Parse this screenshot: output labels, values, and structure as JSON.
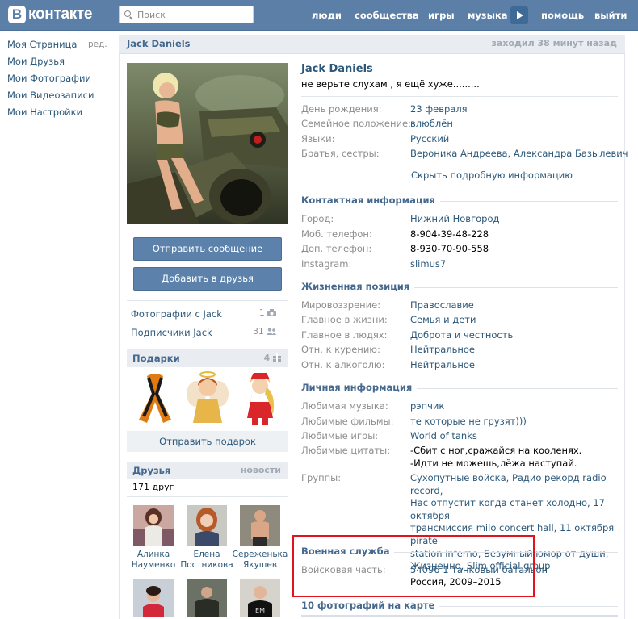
{
  "brand": {
    "logo_letter": "В",
    "logo_text": "контакте"
  },
  "search": {
    "placeholder": "Поиск"
  },
  "topnav": [
    "люди",
    "сообщества",
    "игры",
    "музыка",
    "помощь",
    "выйти"
  ],
  "leftmenu": {
    "items": [
      "Моя Страница",
      "Мои Друзья",
      "Мои Фотографии",
      "Мои Видеозаписи",
      "Мои Настройки"
    ],
    "edit": "ред."
  },
  "header": {
    "name": "Jack Daniels",
    "last_seen": "заходил 38 минут назад"
  },
  "actions": {
    "message": "Отправить сообщение",
    "add_friend": "Добавить в друзья"
  },
  "side_links": [
    {
      "label": "Фотографии с Jack",
      "count": "1"
    },
    {
      "label": "Подписчики Jack",
      "count": "31"
    }
  ],
  "gifts": {
    "title": "Подарки",
    "count": "4",
    "send": "Отправить подарок"
  },
  "friends": {
    "title": "Друзья",
    "news": "новости",
    "count_text": "171 друг",
    "people": [
      {
        "first": "Алинка",
        "last": "Науменко"
      },
      {
        "first": "Елена",
        "last": "Постникова"
      },
      {
        "first": "Сереженька",
        "last": "Якушев"
      }
    ]
  },
  "profile": {
    "name": "Jack Daniels",
    "status": "не верьте слухам , я ещё хуже.........",
    "basic": [
      {
        "label": "День рождения:",
        "value": "23 февраля"
      },
      {
        "label": "Семейное положение:",
        "value": "влюблён"
      },
      {
        "label": "Языки:",
        "value": "Русский"
      },
      {
        "label": "Братья, сестры:",
        "value": "Вероника Андреева, Александра Базылевич"
      }
    ],
    "hide_details": "Скрыть подробную информацию",
    "contacts_title": "Контактная информация",
    "contacts": [
      {
        "label": "Город:",
        "value": "Нижний Новгород"
      },
      {
        "label": "Моб. телефон:",
        "value": "8-904-39-48-228"
      },
      {
        "label": "Доп. телефон:",
        "value": "8-930-70-90-558"
      },
      {
        "label": "Instagram:",
        "value": "slimus7"
      }
    ],
    "life_title": "Жизненная позиция",
    "life": [
      {
        "label": "Мировоззрение:",
        "value": "Православие"
      },
      {
        "label": "Главное в жизни:",
        "value": "Семья и дети"
      },
      {
        "label": "Главное в людях:",
        "value": "Доброта и честность"
      },
      {
        "label": "Отн. к курению:",
        "value": "Нейтральное"
      },
      {
        "label": "Отн. к алкоголю:",
        "value": "Нейтральное"
      }
    ],
    "personal_title": "Личная информация",
    "personal": [
      {
        "label": "Любимая музыка:",
        "value": "рэпчик"
      },
      {
        "label": "Любимые фильмы:",
        "value": "те которые не грузят)))"
      },
      {
        "label": "Любимые игры:",
        "value": "World of tanks"
      },
      {
        "label": "Любимые цитаты:",
        "value": "-Сбит с ног,сражайся на кооленях.",
        "value2": "-Идти не можешь,лёжа наступай."
      }
    ],
    "groups_label": "Группы:",
    "groups_lines": [
      "Сухопутные войска, Радио рекорд radio record,",
      "Нас отпустит когда станет холодно, 17 октября",
      "трансмиссия milo concert hall, 11 октября pirate",
      "station inferno, Безумный юмор от души,",
      "Жизненно, Slim official group"
    ],
    "military_title": "Военная служба",
    "military_label": "Войсковая часть:",
    "military_unit": "54096 1 танковый батальон",
    "military_place": "Россия, 2009–2015",
    "photos_map": "10 фотографий на карте"
  },
  "colors": {
    "topbar": "#5b7fa6",
    "link": "#2b587a",
    "header_text": "#45688e",
    "highlight": "#e0141e"
  }
}
